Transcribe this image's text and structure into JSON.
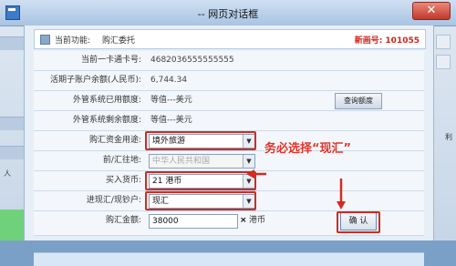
{
  "window": {
    "title": "-- 网页对话框",
    "close_glyph": "✕"
  },
  "header": {
    "label": "当前功能:",
    "function": "购汇委托",
    "new_number": "新画号: 101055"
  },
  "rows": {
    "card": {
      "label": "当前一卡通卡号:",
      "value": "4682036555555555"
    },
    "balance": {
      "label": "活期子账户余额(人民币):",
      "value": "6,744.34"
    },
    "used": {
      "label": "外管系统已用额度:",
      "value": "等值---美元",
      "button": "查询额度"
    },
    "remain": {
      "label": "外管系统剩余额度:",
      "value": "等值---美元"
    },
    "purpose": {
      "label": "购汇资金用途:",
      "value": "境外旅游"
    },
    "country": {
      "label": "前/汇往地:",
      "value": "中华人民共和国"
    },
    "currency": {
      "label": "买入货币:",
      "value": "21 港币"
    },
    "cash": {
      "label": "进现汇/现钞户:",
      "value": "现汇"
    },
    "amount": {
      "label": "购汇金额:",
      "value": "38000",
      "clear": "×",
      "unit": "港币",
      "confirm": "确 认"
    }
  },
  "annotation": "务必选择“现汇”",
  "background": {
    "right_text": "利",
    "left_text": "人"
  },
  "colors": {
    "accent_red": "#d42a1f",
    "new_number": "#d0261d"
  }
}
